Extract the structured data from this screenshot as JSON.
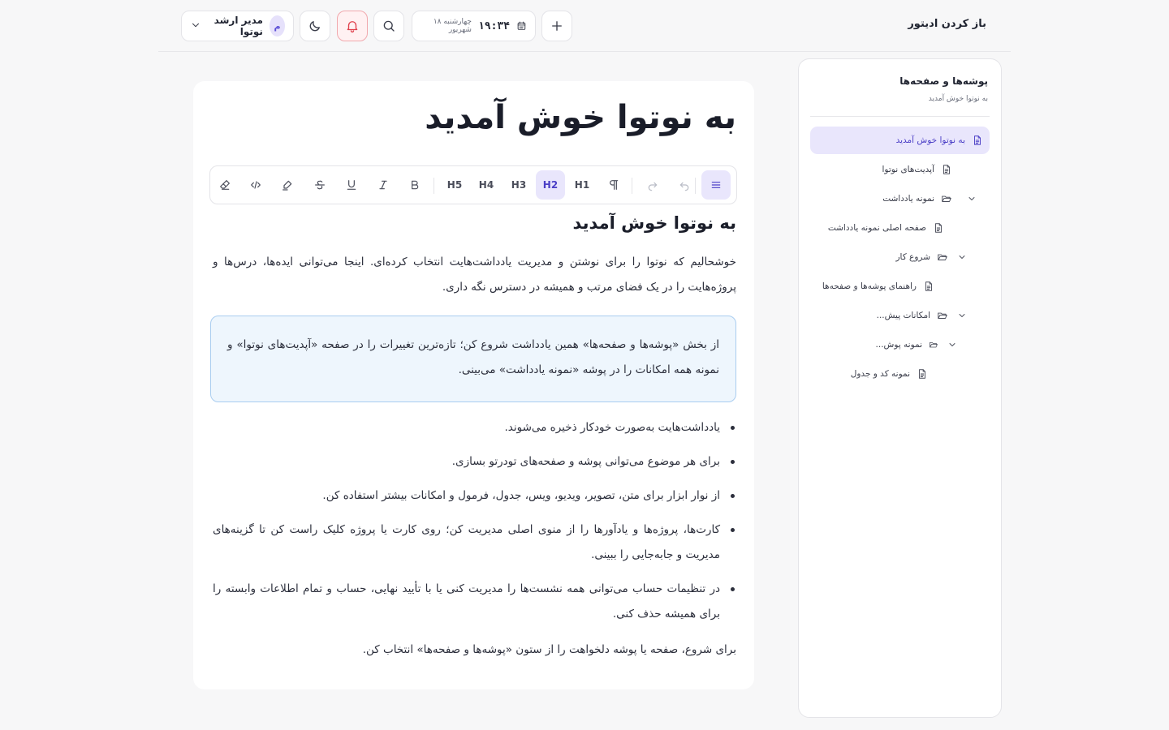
{
  "header": {
    "open_editor": "باز کردن ادیتور",
    "date": {
      "time": "۱۹:۳۴",
      "day": "چهارشنبه ۱۸ شهریور"
    },
    "user": {
      "initial": "م",
      "name": "مدیر ارشد نوتوا"
    }
  },
  "sidebar": {
    "title": "پوشه‌ها و صفحه‌ها",
    "subtitle": "به نوتوا خوش آمدید",
    "items": [
      {
        "label": "به نوتوا خوش آمدید",
        "icon": "file-icon",
        "active": true
      },
      {
        "label": "آپدیت‌های نوتوا",
        "icon": "file-icon"
      },
      {
        "label": "نمونه یادداشت",
        "icon": "folder-icon",
        "expandable": true
      },
      {
        "label": "صفحه اصلی نمونه یادداشت",
        "icon": "file-icon"
      },
      {
        "label": "شروع کار",
        "icon": "folder-icon",
        "expandable": true
      },
      {
        "label": "راهنمای پوشه‌ها و صفحه‌ها",
        "icon": "file-icon"
      },
      {
        "label": "امکانات پیش...",
        "icon": "folder-icon",
        "expandable": true
      },
      {
        "label": "نمونه پوش...",
        "icon": "folder-icon",
        "expandable": true
      },
      {
        "label": "نمونه کد و جدول",
        "icon": "file-icon"
      }
    ]
  },
  "toolbar": {
    "headings": [
      "H1",
      "H2",
      "H3",
      "H4",
      "H5"
    ],
    "active_heading": "H2"
  },
  "document": {
    "title": "به نوتوا خوش آمدید",
    "heading": "به نوتوا خوش آمدید",
    "intro": "خوشحالیم که نوتوا را برای نوشتن و مدیریت یادداشت‌هایت انتخاب کرده‌ای. اینجا می‌توانی ایده‌ها، درس‌ها و پروژه‌هایت را در یک فضای مرتب و همیشه در دسترس نگه داری.",
    "callout": "از بخش «پوشه‌ها و صفحه‌ها» همین یادداشت شروع کن؛ تازه‌ترین تغییرات را در صفحه «آپدیت‌های نوتوا» و نمونه همه امکانات را در پوشه «نمونه یادداشت» می‌بینی.",
    "bullets": [
      "یادداشت‌هایت به‌صورت خودکار ذخیره می‌شوند.",
      "برای هر موضوع می‌توانی پوشه و صفحه‌های تودرتو بسازی.",
      "از نوار ابزار برای متن، تصویر، ویدیو، ویس، جدول، فرمول و امکانات بیشتر استفاده کن.",
      "کارت‌ها، پروژه‌ها و یادآورها را از منوی اصلی مدیریت کن؛ روی کارت یا پروژه کلیک راست کن تا گزینه‌های مدیریت و جابه‌جایی را ببینی.",
      "در تنظیمات حساب می‌توانی همه نشست‌ها را مدیریت کنی یا با تأیید نهایی، حساب و تمام اطلاعات وابسته را برای همیشه حذف کنی."
    ],
    "outro": "برای شروع، صفحه یا پوشه دلخواهت را از ستون «پوشه‌ها و صفحه‌ها» انتخاب کن."
  },
  "colors": {
    "accent": "#4b3fc6",
    "accent_bg": "#e9e6fc",
    "alert": "#e0404c",
    "callout_bg": "#eef6fd",
    "callout_border": "#a9cdf0"
  }
}
